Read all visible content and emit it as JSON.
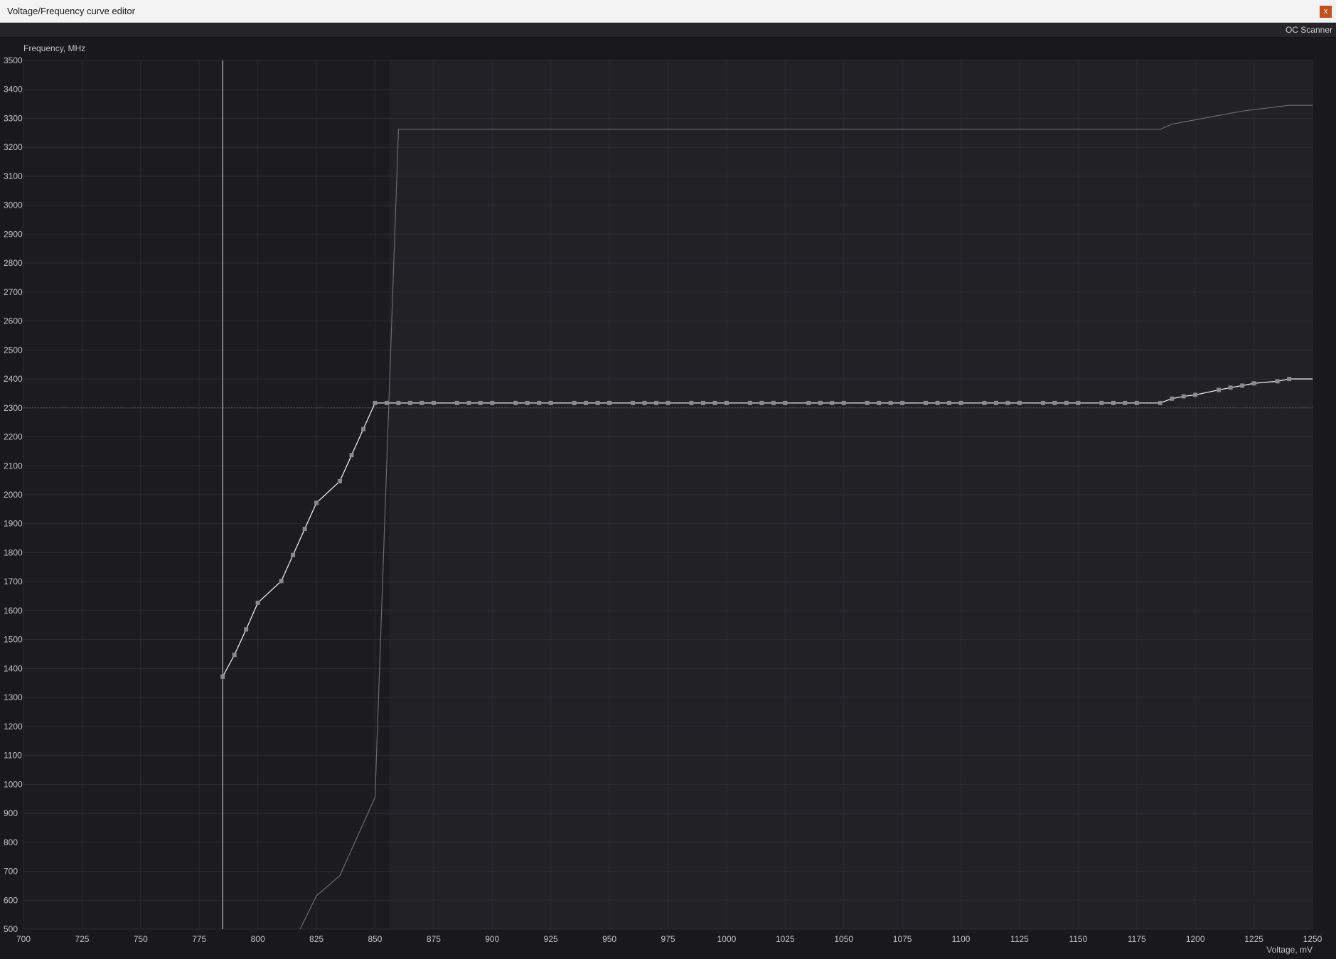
{
  "window": {
    "title": "Voltage/Frequency curve editor",
    "close_label": "x"
  },
  "toolbar": {
    "oc_scanner_label": "OC Scanner"
  },
  "colors": {
    "background": "#19191b",
    "plot_background": "#1c1c1f",
    "plot_background_active": "#212126",
    "grid": "#2b2b30",
    "curve": "#e8e8e8",
    "point": "#8a8a8a",
    "limit_line": "#6b6b6b",
    "marker_line": "#e2e2e2",
    "close_button": "#c1521d"
  },
  "chart_data": {
    "type": "line",
    "title": "",
    "xlabel": "Voltage, mV",
    "ylabel": "Frequency, MHz",
    "xlim": [
      700,
      1250
    ],
    "ylim": [
      500,
      3500
    ],
    "grid": true,
    "x_ticks": [
      700,
      725,
      750,
      775,
      800,
      825,
      850,
      875,
      900,
      925,
      950,
      975,
      1000,
      1025,
      1050,
      1075,
      1100,
      1125,
      1150,
      1175,
      1200,
      1225,
      1250
    ],
    "y_ticks": [
      500,
      600,
      700,
      800,
      900,
      1000,
      1100,
      1200,
      1300,
      1400,
      1500,
      1600,
      1700,
      1800,
      1900,
      2000,
      2100,
      2200,
      2300,
      2400,
      2500,
      2600,
      2700,
      2800,
      2900,
      3000,
      3100,
      3200,
      3300,
      3400,
      3500
    ],
    "highlighted_region_start_x": 856,
    "selected_voltage_marker_x": 785,
    "reference_frequency_y": 2300,
    "series": [
      {
        "points_x": [
          785,
          790,
          795,
          800,
          810,
          815,
          820,
          825,
          835,
          840,
          845,
          850,
          855,
          860,
          865,
          870,
          875,
          885,
          890,
          895,
          900,
          910,
          915,
          920,
          925,
          935,
          940,
          945,
          950,
          960,
          965,
          970,
          975,
          985,
          990,
          995,
          1000,
          1010,
          1015,
          1020,
          1025,
          1035,
          1040,
          1045,
          1050,
          1060,
          1065,
          1070,
          1075,
          1085,
          1090,
          1095,
          1100,
          1110,
          1115,
          1120,
          1125,
          1135,
          1140,
          1145,
          1150,
          1160,
          1165,
          1170,
          1175,
          1185,
          1190,
          1195,
          1200,
          1210,
          1215,
          1220,
          1225,
          1235,
          1240,
          1250
        ],
        "points_y": [
          1372,
          1447,
          1535,
          1627,
          1702,
          1792,
          1882,
          1972,
          2047,
          2137,
          2227,
          2317,
          2317,
          2317,
          2317,
          2317,
          2317,
          2317,
          2317,
          2317,
          2317,
          2317,
          2317,
          2317,
          2317,
          2317,
          2317,
          2317,
          2317,
          2317,
          2317,
          2317,
          2317,
          2317,
          2317,
          2317,
          2317,
          2317,
          2317,
          2317,
          2317,
          2317,
          2317,
          2317,
          2317,
          2317,
          2317,
          2317,
          2317,
          2317,
          2317,
          2317,
          2317,
          2317,
          2317,
          2317,
          2317,
          2317,
          2317,
          2317,
          2317,
          2317,
          2317,
          2317,
          2317,
          2317,
          2332,
          2340,
          2345,
          2362,
          2370,
          2377,
          2385,
          2392,
          2400,
          2400
        ]
      },
      {
        "points_x": [
          818,
          825,
          835,
          850,
          860,
          1185,
          1190,
          1200,
          1210,
          1220,
          1230,
          1240,
          1250
        ],
        "points_y": [
          500,
          615,
          685,
          955,
          3262,
          3262,
          3280,
          3295,
          3310,
          3325,
          3335,
          3345,
          3345
        ]
      }
    ]
  }
}
